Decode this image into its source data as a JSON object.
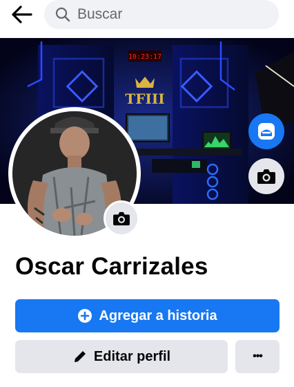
{
  "search": {
    "placeholder": "Buscar"
  },
  "cover": {
    "clock_text": "10:23:17",
    "logo_text": "TFIII"
  },
  "profile": {
    "name": "Oscar Carrizales"
  },
  "actions": {
    "add_story_label": "Agregar a historia",
    "edit_profile_label": "Editar perfil",
    "more_label": "•••"
  },
  "icons": {
    "back": "arrow-left-icon",
    "search": "search-icon",
    "avatar_frame": "avatar-frame-icon",
    "camera": "camera-icon",
    "add_story": "plus-circle-icon",
    "edit": "pencil-icon",
    "more": "more-dots-icon"
  },
  "colors": {
    "primary": "#1877f2",
    "secondary_bg": "#e4e6eb",
    "search_bg": "#f0f2f5",
    "text": "#050505",
    "muted": "#65676b"
  }
}
